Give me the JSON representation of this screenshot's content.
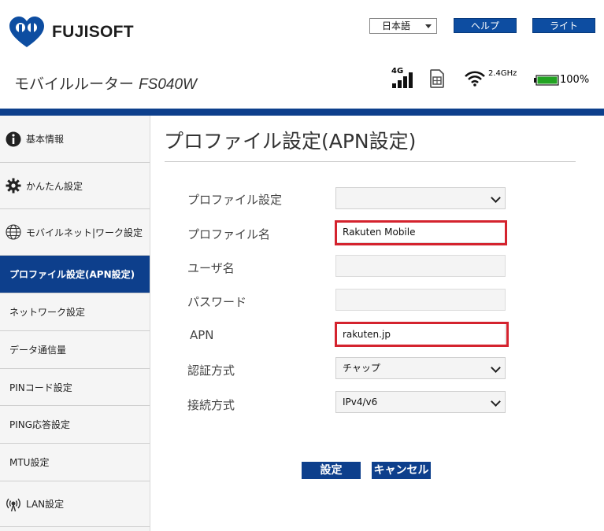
{
  "brand": {
    "name": "FUJISOFT",
    "product_name": "モバイルルーター",
    "product_model": "FS040W"
  },
  "header": {
    "language": "日本語",
    "help_label": "ヘルプ",
    "light_label": "ライト"
  },
  "status": {
    "network_type": "4G",
    "signal_icon": "signal-bars-icon",
    "sim_icon": "sim-card-icon",
    "wifi_icon": "wifi-icon",
    "wifi_band": "2.4GHz",
    "battery_icon": "battery-icon",
    "battery_percent": "100%",
    "battery_level": 1.0
  },
  "sidebar": {
    "items": [
      {
        "label": "基本情報",
        "icon": "info-icon"
      },
      {
        "label": "かんたん設定",
        "icon": "gear-icon"
      },
      {
        "label": "モバイルネット|ワーク設定",
        "icon": "globe-icon"
      },
      {
        "label": "プロファイル設定(APN設定)",
        "icon": ""
      },
      {
        "label": "ネットワーク設定",
        "icon": ""
      },
      {
        "label": "データ通信量",
        "icon": ""
      },
      {
        "label": "PINコード設定",
        "icon": ""
      },
      {
        "label": "PING応答設定",
        "icon": ""
      },
      {
        "label": "MTU設定",
        "icon": ""
      },
      {
        "label": "LAN設定",
        "icon": "antenna-icon"
      }
    ]
  },
  "main": {
    "title": "プロファイル設定(APN設定)",
    "form": {
      "profile_select_label": "プロファイル設定",
      "profile_select_value": "",
      "profile_name_label": "プロファイル名",
      "profile_name_value": "Rakuten Mobile",
      "username_label": "ユーザ名",
      "username_value": "",
      "password_label": "パスワード",
      "password_value": "",
      "apn_label": "APN",
      "apn_value": "rakuten.jp",
      "auth_label": "認証方式",
      "auth_value": "チャップ",
      "connection_label": "接続方式",
      "connection_value": "IPv4/v6"
    },
    "set_label": "設定",
    "cancel_label": "キャンセル"
  },
  "colors": {
    "brand_blue": "#0d3f8c",
    "highlight_red": "#d4232e",
    "battery_green": "#22a322"
  }
}
